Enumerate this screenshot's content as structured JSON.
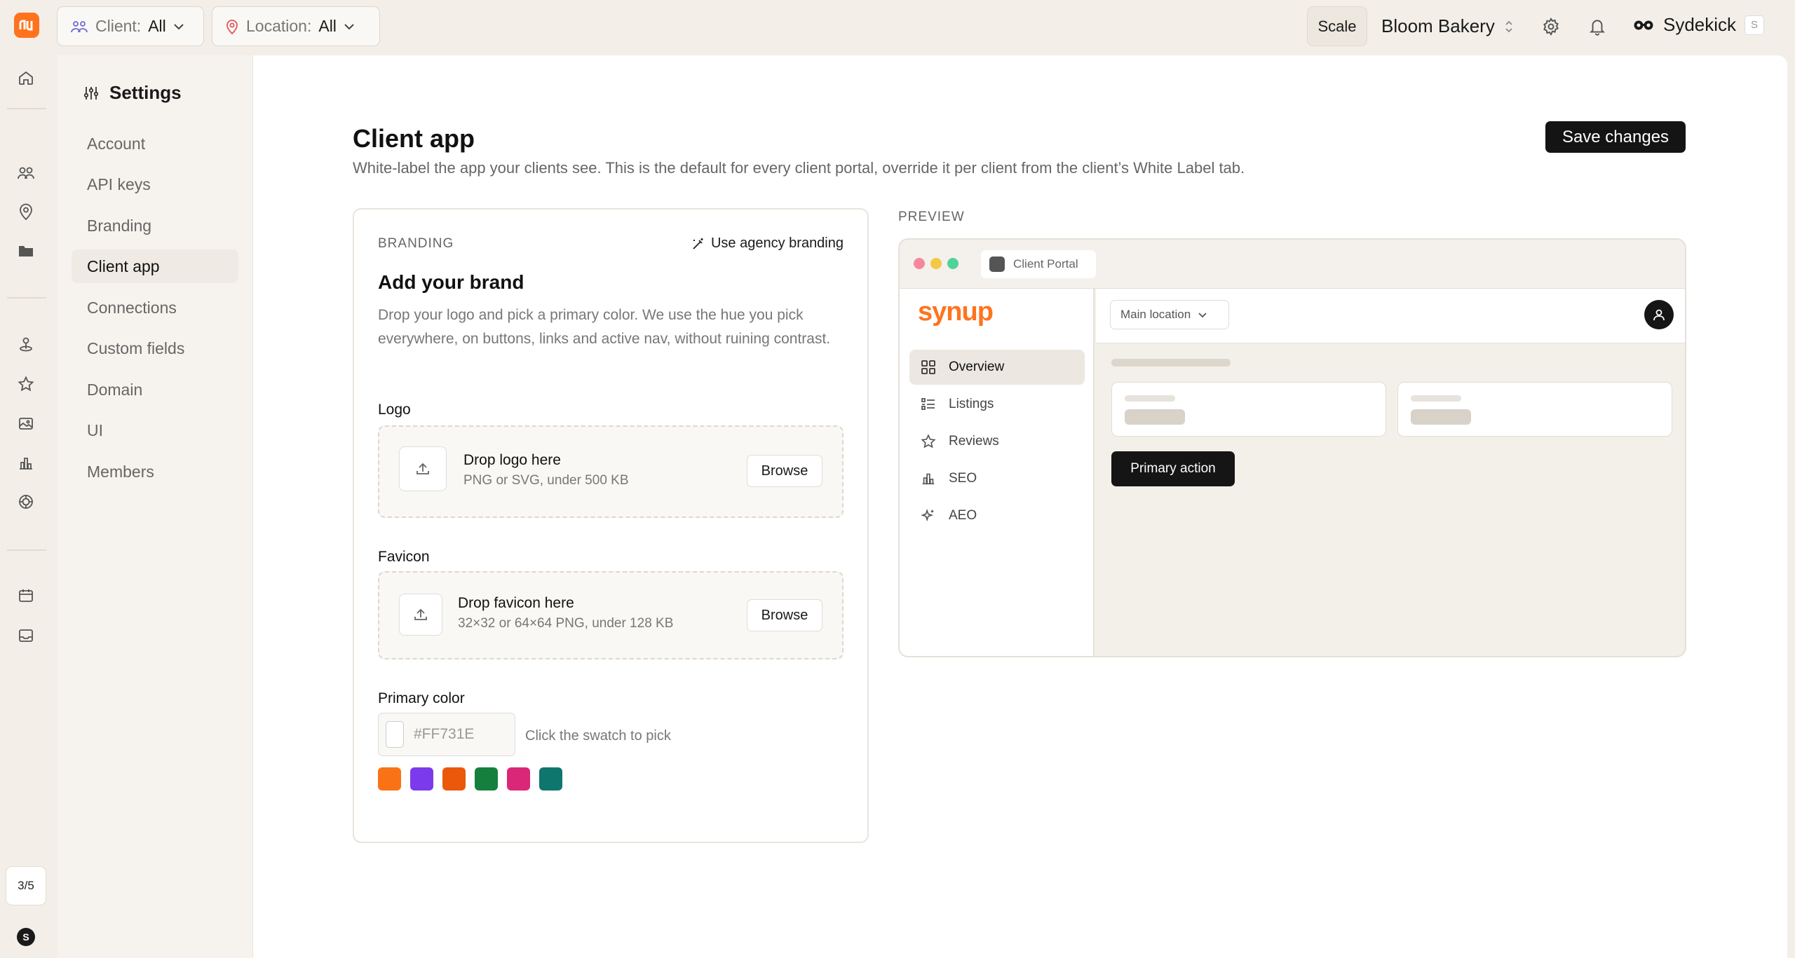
{
  "rail": {
    "step_counter": "3/5",
    "avatar_initial": "S",
    "icons": [
      "home-icon",
      "clients-icon",
      "location-pin-icon",
      "folder-icon",
      "map-pin-icon",
      "star-icon",
      "gallery-icon",
      "bar-chart-icon",
      "ai-icon",
      "calendar-icon",
      "inbox-icon"
    ]
  },
  "topbar": {
    "client_filter": {
      "label": "Client:",
      "value": "All"
    },
    "location_filter": {
      "label": "Location:",
      "value": "All"
    },
    "plan_badge": "Scale",
    "business_name": "Bloom Bakery",
    "assistant_name": "Sydekick",
    "assistant_shortcut": "S"
  },
  "settings_nav": {
    "title": "Settings",
    "items": [
      {
        "label": "Account"
      },
      {
        "label": "API keys"
      },
      {
        "label": "Branding"
      },
      {
        "label": "Client app",
        "active": true
      },
      {
        "label": "Connections"
      },
      {
        "label": "Custom fields"
      },
      {
        "label": "Domain"
      },
      {
        "label": "UI"
      },
      {
        "label": "Members"
      }
    ]
  },
  "page": {
    "title": "Client app",
    "description": "White-label the app your clients see. This is the default for every client portal, override it per client from the client’s White Label tab.",
    "save_label": "Save changes"
  },
  "branding": {
    "eyebrow": "BRANDING",
    "agency_link": "Use agency branding",
    "heading": "Add your brand",
    "description": "Drop your logo and pick a primary color. We use the hue you pick everywhere, on buttons, links and active nav, without ruining contrast.",
    "logo": {
      "label": "Logo",
      "title": "Drop logo here",
      "subtitle": "PNG or SVG, under 500 KB",
      "button": "Browse"
    },
    "favicon": {
      "label": "Favicon",
      "title": "Drop favicon here",
      "subtitle": "32×32 or 64×64 PNG, under 128 KB",
      "button": "Browse"
    },
    "primary_color": {
      "label": "Primary color",
      "placeholder": "#FF731E",
      "hint": "Click the swatch to pick",
      "swatches": [
        "#f97316",
        "#7c3aed",
        "#ea580c",
        "#15803d",
        "#db2777",
        "#0f766e"
      ]
    }
  },
  "preview": {
    "label": "PREVIEW",
    "tab_title": "Client Portal",
    "brand": "synup",
    "brand_color": "#ff731e",
    "location_select": "Main location",
    "nav": [
      {
        "label": "Overview",
        "icon": "grid-icon",
        "active": true
      },
      {
        "label": "Listings",
        "icon": "list-icon"
      },
      {
        "label": "Reviews",
        "icon": "star-icon"
      },
      {
        "label": "SEO",
        "icon": "bar-chart-icon"
      },
      {
        "label": "AEO",
        "icon": "sparkle-icon"
      }
    ],
    "primary_action": "Primary action"
  }
}
